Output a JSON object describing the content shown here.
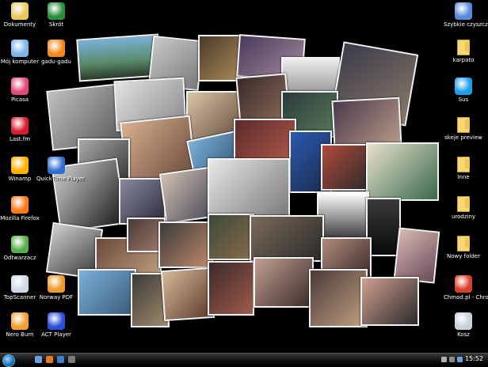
{
  "desktop": {
    "icons_left": [
      {
        "name": "documents-icon",
        "label": "Dokumenty",
        "color": "#e9c95a"
      },
      {
        "name": "windows-icon",
        "label": "Mój komputer",
        "color": "#7cb3e8"
      },
      {
        "name": "picasa-icon",
        "label": "Picasa",
        "color": "#e04a7a"
      },
      {
        "name": "lastfm-icon",
        "label": "Last.fm",
        "color": "#d81e2c"
      },
      {
        "name": "winamp-icon",
        "label": "Winamp",
        "color": "#ffb000"
      },
      {
        "name": "firefox-icon",
        "label": "Mozilla Firefox",
        "color": "#ff7a1a"
      },
      {
        "name": "player-icon",
        "label": "Odtwarzacz",
        "color": "#56b04a"
      },
      {
        "name": "magnifier-icon",
        "label": "TopScanner",
        "color": "#cfd8e6"
      },
      {
        "name": "firefox-burn-icon",
        "label": "Nero Burn",
        "color": "#f0a030"
      }
    ],
    "icons_col2": [
      {
        "name": "shortcut-icon",
        "label": "Skrót",
        "color": "#2a8f3a"
      },
      {
        "name": "gadu-gadu-icon",
        "label": "gadu-gadu",
        "color": "#f08a1a"
      },
      {
        "name": "quicktime-icon",
        "label": "QuickTime Player",
        "color": "#2f6fd0"
      },
      {
        "name": "pdf-icon",
        "label": "Norway PDF",
        "color": "#ef9a2a"
      },
      {
        "name": "arial-icon",
        "label": "ACT Player",
        "color": "#2a4fd8"
      }
    ],
    "icons_right": [
      {
        "name": "shortcut-right-icon",
        "label": "Szybkie czyszczenie",
        "type": "app",
        "color": "#5a8ad8"
      },
      {
        "name": "folder-icon",
        "label": "karpato",
        "type": "folder"
      },
      {
        "name": "skype-icon",
        "label": "Sus",
        "type": "app",
        "color": "#1aa0e8"
      },
      {
        "name": "folder-icon",
        "label": "skeje preview",
        "type": "folder"
      },
      {
        "name": "folder-icon",
        "label": "Inne",
        "type": "folder"
      },
      {
        "name": "folder-icon",
        "label": "urodziny",
        "type": "folder"
      },
      {
        "name": "folder-icon",
        "label": "Nowy folder",
        "type": "folder"
      },
      {
        "name": "app-icon",
        "label": "Chmod.pl - Chrome.htm",
        "type": "app",
        "color": "#d8402a"
      },
      {
        "name": "recycle-bin-icon",
        "label": "Kosz",
        "type": "app",
        "color": "#c8d0da"
      }
    ]
  },
  "taskbar": {
    "clock": "15:52",
    "pinned_colors": [
      "#6aa0e0",
      "#e87a20",
      "#3a7fd0",
      "#7a7a7a"
    ]
  }
}
